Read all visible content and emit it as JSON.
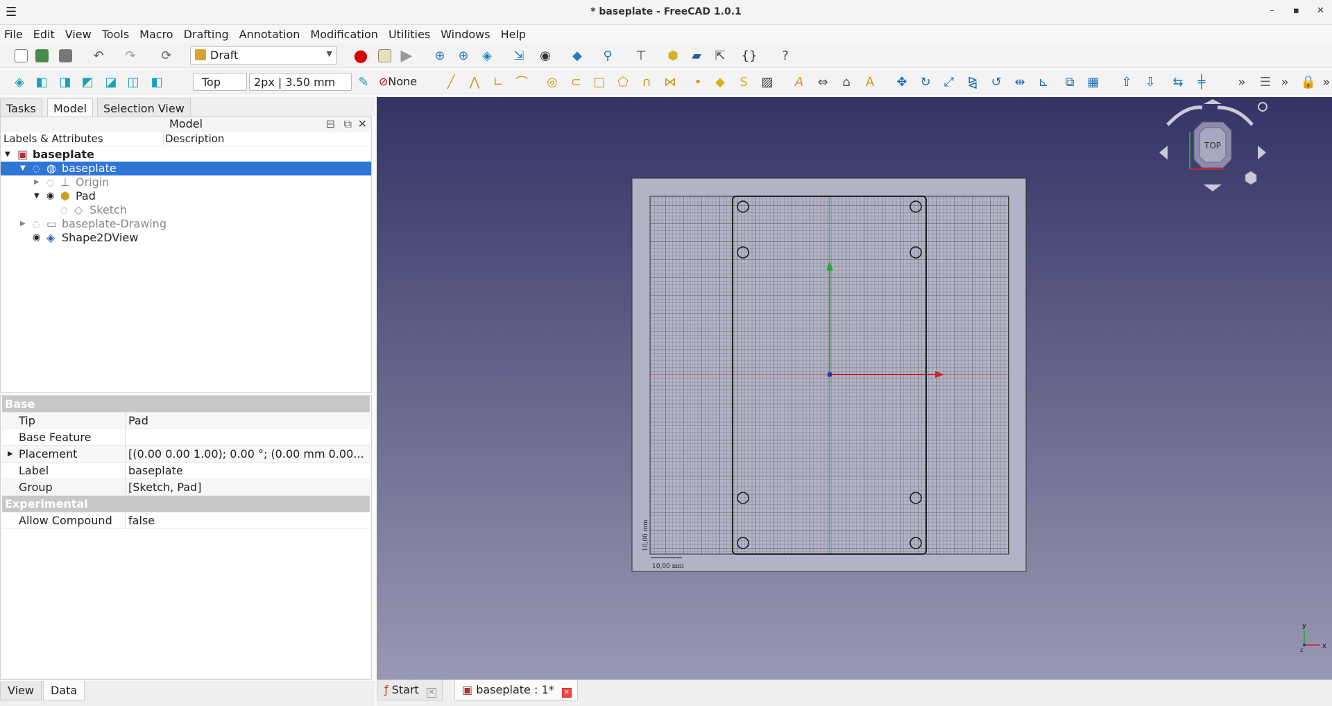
{
  "window": {
    "title": "* baseplate - FreeCAD 1.0.1",
    "minimize": "–",
    "maximize": "▪",
    "close": "✕"
  },
  "menu": [
    "File",
    "Edit",
    "View",
    "Tools",
    "Macro",
    "Drafting",
    "Annotation",
    "Modification",
    "Utilities",
    "Windows",
    "Help"
  ],
  "toolbar": {
    "workbench": "Draft",
    "view": "Top",
    "style": "2px | 3.50 mm",
    "construction": "None"
  },
  "panel_tabs": [
    "Tasks",
    "Model",
    "Selection View"
  ],
  "model": {
    "header": "Model",
    "col_labels": "Labels & Attributes",
    "col_desc": "Description",
    "tree": [
      {
        "label": "baseplate",
        "level": 0
      },
      {
        "label": "baseplate",
        "level": 1
      },
      {
        "label": "Origin",
        "level": 2
      },
      {
        "label": "Pad",
        "level": 2
      },
      {
        "label": "Sketch",
        "level": 3
      },
      {
        "label": "baseplate-Drawing",
        "level": 1
      },
      {
        "label": "Shape2DView",
        "level": 1
      }
    ]
  },
  "properties": {
    "group_base": "Base",
    "rows": [
      {
        "key": "Tip",
        "value": "Pad"
      },
      {
        "key": "Base Feature",
        "value": ""
      },
      {
        "key": "Placement",
        "value": "[(0.00 0.00 1.00); 0.00 °; (0.00 mm  0.00..."
      },
      {
        "key": "Label",
        "value": "baseplate"
      },
      {
        "key": "Group",
        "value": "[Sketch, Pad]"
      }
    ],
    "group_exp": "Experimental",
    "exp_rows": [
      {
        "key": "Allow Compound",
        "value": "false"
      }
    ]
  },
  "bottom_tabs": [
    "View",
    "Data"
  ],
  "doc_tabs": [
    "Start",
    "baseplate : 1*"
  ],
  "viewport": {
    "navcube_face": "TOP",
    "scale_x": "10,00 mm",
    "scale_y": "10,00 mm",
    "axis_x": "x",
    "axis_y": "y",
    "axis_z": "z",
    "colors": {
      "bg_top": "#333366",
      "bg_bottom": "#9999b3",
      "x_axis": "#cc2222",
      "y_axis": "#22aa33",
      "selection": "#2f75d6"
    }
  }
}
